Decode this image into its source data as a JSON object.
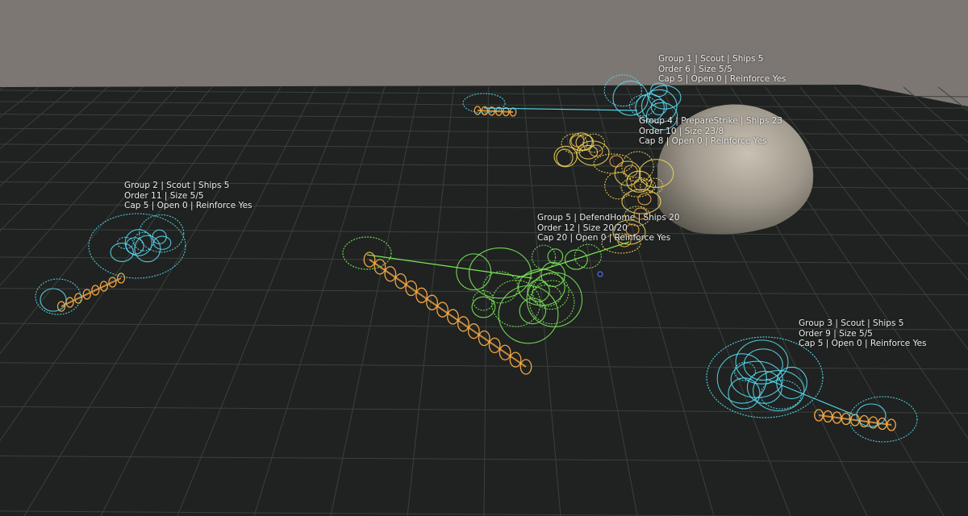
{
  "scene": {
    "sky_color": "#7d7773",
    "ground_color": "#1f2220",
    "grid_color": "#3a403d",
    "colors": {
      "scout": "#59d8f0",
      "strike": "#f0d35a",
      "defend": "#7ce85a",
      "ship_chain": "#f2a545",
      "planet": "#9d968a"
    }
  },
  "groups": [
    {
      "id": "g1",
      "line1": "Group 1 | Scout | Ships 5",
      "line2": "Order 6 | Size 5/5",
      "line3": "Cap 5 | Open 0 | Reinforce Yes"
    },
    {
      "id": "g4",
      "line1": "Group 4 | PrepareStrike | Ships 23",
      "line2": "Order 10 | Size 23/8",
      "line3": "Cap 8 | Open 0 | Reinforce Yes"
    },
    {
      "id": "g2",
      "line1": "Group 2 | Scout | Ships 5",
      "line2": "Order 11 | Size 5/5",
      "line3": "Cap 5 | Open 0 | Reinforce Yes"
    },
    {
      "id": "g5",
      "line1": "Group 5 | DefendHome | Ships 20",
      "line2": "Order 12 | Size 20/20",
      "line3": "Cap 20 | Open 0 | Reinforce Yes"
    },
    {
      "id": "g3",
      "line1": "Group 3 | Scout | Ships 5",
      "line2": "Order 9 | Size 5/5",
      "line3": "Cap 5 | Open 0 | Reinforce Yes"
    }
  ]
}
